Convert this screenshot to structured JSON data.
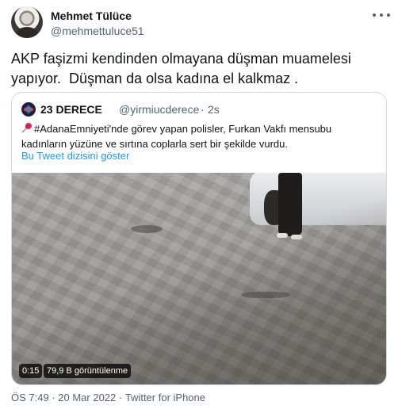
{
  "author": {
    "name": "Mehmet Tülüce",
    "handle": "@mehmettuluce51"
  },
  "tweet": {
    "text": "AKP faşizmi kendinden olmayana düşman muamelesi yapıyor.  Düşman da olsa kadına el kalkmaz ."
  },
  "quoted": {
    "name": "23 DERECE",
    "handle": "@yirmiucderece",
    "separator": "·",
    "time": "2s",
    "text": "#AdanaEmniyeti'nde görev yapan polisler, Furkan Vakfı mensubu kadınların yüzüne ve sırtına coplarla sert bir şekilde vurdu.",
    "show_thread_link": "Bu Tweet dizisini göster",
    "icon": "pushpin-icon"
  },
  "media": {
    "duration": "0:15",
    "views": "79,9 B görüntülenme"
  },
  "meta": {
    "time": "ÖS 7:49",
    "sep1": " · ",
    "date": "20 Mar 2022",
    "sep2": " · ",
    "source": "Twitter for iPhone"
  },
  "colors": {
    "link": "#1d9bf0",
    "secondary_text": "#536471",
    "border": "#cfd9de"
  }
}
